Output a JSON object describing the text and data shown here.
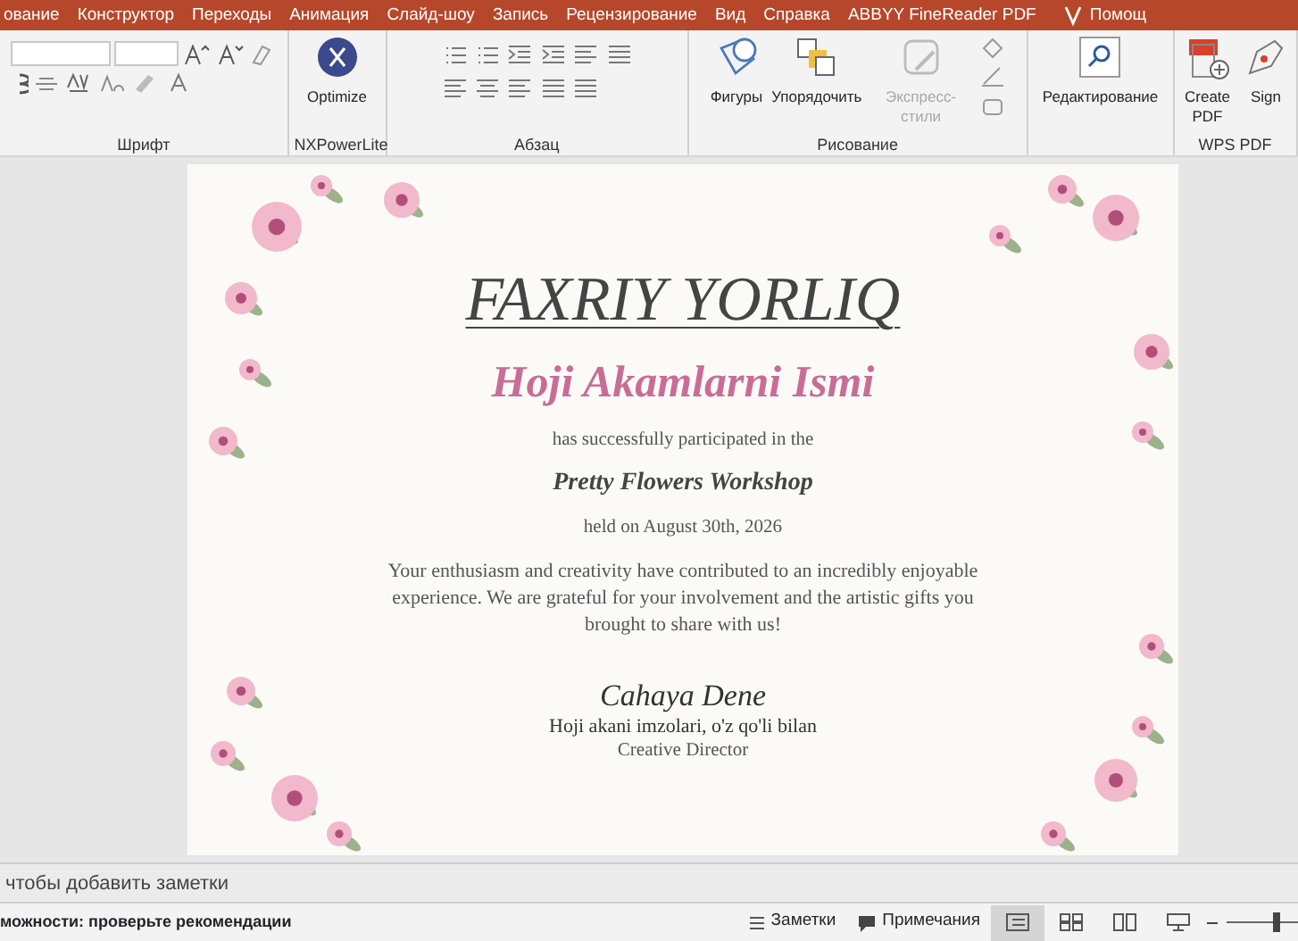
{
  "ribbon_tabs": [
    "ование",
    "Конструктор",
    "Переходы",
    "Анимация",
    "Слайд-шоу",
    "Запись",
    "Рецензирование",
    "Вид",
    "Справка",
    "ABBYY FineReader PDF",
    "Помощ"
  ],
  "ribbon_groups": [
    {
      "kind": "font",
      "label": "Шрифт"
    },
    {
      "kind": "nxpowerlite",
      "label": "NXPowerLite",
      "buttons": [
        {
          "label": "Optimize",
          "disabled": false
        }
      ]
    },
    {
      "kind": "paragraph",
      "label": "Абзац"
    },
    {
      "kind": "drawing",
      "label": "Рисование",
      "buttons": [
        {
          "label": "Фигуры",
          "disabled": false
        },
        {
          "label": "Упорядочить",
          "disabled": false
        },
        {
          "label": "Экспресс-стили",
          "disabled": true
        }
      ]
    },
    {
      "kind": "editing",
      "buttons": [
        {
          "label": "Редактирование",
          "disabled": false
        }
      ]
    },
    {
      "kind": "pdf",
      "label": "WPS PDF",
      "buttons": [
        {
          "label": "Create PDF",
          "disabled": false
        },
        {
          "label": "Sign",
          "disabled": false
        }
      ]
    }
  ],
  "certificate": {
    "title": "FAXRIY YORLIQ",
    "recipient": "Hoji Akamlarni Ismi",
    "intro": "has successfully participated in the",
    "event": "Pretty Flowers Workshop",
    "date": "held on August 30th, 2026",
    "message": "Your enthusiasm and creativity have contributed to an incredibly enjoyable experience. We are grateful for your involvement and the artistic gifts you brought to share with us!",
    "signature": "Cahaya Dene",
    "signer": "Hoji akani imzolari, o'z qo'li bilan",
    "signer_role": "Creative Director"
  },
  "notes": {
    "placeholder": "чтобы добавить заметки"
  },
  "status_bar": {
    "message": "можности: проверьте рекомендации",
    "notes_button": "Заметки",
    "comments_button": "Примечания",
    "views": [
      {
        "selected": true
      },
      {
        "selected": false
      },
      {
        "selected": false
      },
      {
        "selected": false
      }
    ],
    "zoom_slider": {
      "level": 0.7
    }
  }
}
